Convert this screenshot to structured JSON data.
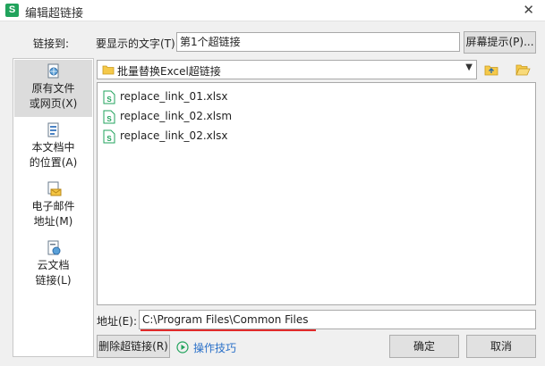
{
  "window": {
    "title": "编辑超链接",
    "app_icon_letter": "S",
    "close_glyph": "✕"
  },
  "link_to_label": "链接到:",
  "display_text": {
    "label": "要显示的文字(T):",
    "value": "第1个超链接"
  },
  "screen_tip_button": "屏幕提示(P)...",
  "sidebar": {
    "items": [
      {
        "label": "原有文件\n或网页(X)",
        "icon": "globe-file-icon",
        "selected": true
      },
      {
        "label": "本文档中\n的位置(A)",
        "icon": "document-place-icon",
        "selected": false
      },
      {
        "label": "电子邮件\n地址(M)",
        "icon": "email-icon",
        "selected": false
      },
      {
        "label": "云文档\n链接(L)",
        "icon": "cloud-doc-icon",
        "selected": false
      }
    ]
  },
  "folder": {
    "name": "批量替换Excel超链接",
    "dropdown_glyph": "▼"
  },
  "files": [
    {
      "name": "replace_link_01.xlsx"
    },
    {
      "name": "replace_link_02.xlsm"
    },
    {
      "name": "replace_link_02.xlsx"
    }
  ],
  "address": {
    "label": "地址(E):",
    "value": "C:\\Program Files\\Common Files"
  },
  "remove_link_button": "删除超链接(R)",
  "help_link": "操作技巧",
  "ok_button": "确定",
  "cancel_button": "取消",
  "colors": {
    "accent_green": "#21a35c",
    "link_blue": "#2a70c8",
    "highlight_red": "#e02a2a"
  }
}
